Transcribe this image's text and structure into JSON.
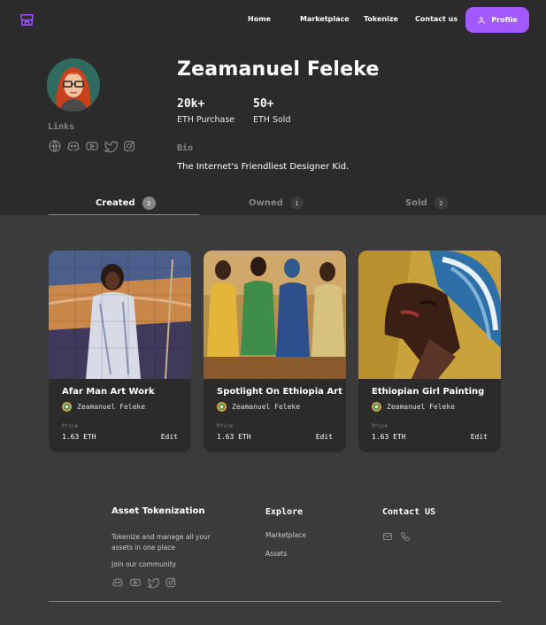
{
  "nav": {
    "logo_icon": "storefront-icon",
    "links": [
      "Home",
      "Marketplace",
      "Tokenize",
      "Contact us"
    ],
    "profile_label": "Profile",
    "profile_icon": "user-icon",
    "accent_color": "#a259ff"
  },
  "profile": {
    "name": "Zeamanuel Feleke",
    "stats": [
      {
        "value": "20k+",
        "label": "ETH Purchase"
      },
      {
        "value": "50+",
        "label": "ETH Sold"
      }
    ],
    "bio_label": "Bio",
    "bio": "The Internet's Friendliest Designer Kid.",
    "links_label": "Links",
    "link_icons": [
      "globe-icon",
      "discord-icon",
      "youtube-icon",
      "twitter-icon",
      "instagram-icon"
    ]
  },
  "tabs": [
    {
      "label": "Created",
      "count": "3",
      "active": true
    },
    {
      "label": "Owned",
      "count": "1",
      "active": false
    },
    {
      "label": "Sold",
      "count": "2",
      "active": false
    }
  ],
  "cards": [
    {
      "title": "Afar Man Art Work",
      "artist": "Zeamanuel Feleke",
      "price_label": "Price",
      "price": "1.63 ETH",
      "action": "Edit"
    },
    {
      "title": "Spotlight On Ethiopia Art",
      "artist": "Zeamanuel Feleke",
      "price_label": "Price",
      "price": "1.63 ETH",
      "action": "Edit"
    },
    {
      "title": "Ethiopian Girl Painting",
      "artist": "Zeamanuel Feleke",
      "price_label": "Price",
      "price": "1.63 ETH",
      "action": "Edit"
    }
  ],
  "footer": {
    "brand_title": "Asset Tokenization",
    "brand_text": "Tokenize and manage all your assets in one place",
    "community_label": "Join our community",
    "community_icons": [
      "discord-icon",
      "youtube-icon",
      "twitter-icon",
      "instagram-icon"
    ],
    "explore_title": "Explore",
    "explore_links": [
      "Marketplace",
      "Assets"
    ],
    "contact_title": "Contact US",
    "contact_icons": [
      "mail-icon",
      "phone-icon"
    ]
  }
}
